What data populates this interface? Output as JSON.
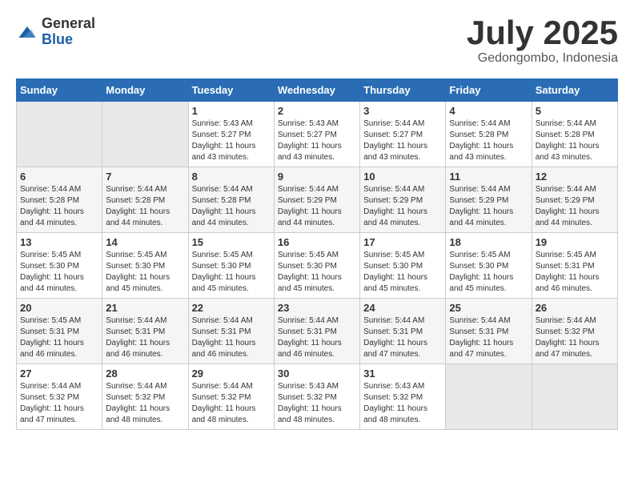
{
  "header": {
    "logo_general": "General",
    "logo_blue": "Blue",
    "month": "July 2025",
    "location": "Gedongombo, Indonesia"
  },
  "days_of_week": [
    "Sunday",
    "Monday",
    "Tuesday",
    "Wednesday",
    "Thursday",
    "Friday",
    "Saturday"
  ],
  "weeks": [
    [
      {
        "day": "",
        "sunrise": "",
        "sunset": "",
        "daylight": ""
      },
      {
        "day": "",
        "sunrise": "",
        "sunset": "",
        "daylight": ""
      },
      {
        "day": "1",
        "sunrise": "Sunrise: 5:43 AM",
        "sunset": "Sunset: 5:27 PM",
        "daylight": "Daylight: 11 hours and 43 minutes."
      },
      {
        "day": "2",
        "sunrise": "Sunrise: 5:43 AM",
        "sunset": "Sunset: 5:27 PM",
        "daylight": "Daylight: 11 hours and 43 minutes."
      },
      {
        "day": "3",
        "sunrise": "Sunrise: 5:44 AM",
        "sunset": "Sunset: 5:27 PM",
        "daylight": "Daylight: 11 hours and 43 minutes."
      },
      {
        "day": "4",
        "sunrise": "Sunrise: 5:44 AM",
        "sunset": "Sunset: 5:28 PM",
        "daylight": "Daylight: 11 hours and 43 minutes."
      },
      {
        "day": "5",
        "sunrise": "Sunrise: 5:44 AM",
        "sunset": "Sunset: 5:28 PM",
        "daylight": "Daylight: 11 hours and 43 minutes."
      }
    ],
    [
      {
        "day": "6",
        "sunrise": "Sunrise: 5:44 AM",
        "sunset": "Sunset: 5:28 PM",
        "daylight": "Daylight: 11 hours and 44 minutes."
      },
      {
        "day": "7",
        "sunrise": "Sunrise: 5:44 AM",
        "sunset": "Sunset: 5:28 PM",
        "daylight": "Daylight: 11 hours and 44 minutes."
      },
      {
        "day": "8",
        "sunrise": "Sunrise: 5:44 AM",
        "sunset": "Sunset: 5:28 PM",
        "daylight": "Daylight: 11 hours and 44 minutes."
      },
      {
        "day": "9",
        "sunrise": "Sunrise: 5:44 AM",
        "sunset": "Sunset: 5:29 PM",
        "daylight": "Daylight: 11 hours and 44 minutes."
      },
      {
        "day": "10",
        "sunrise": "Sunrise: 5:44 AM",
        "sunset": "Sunset: 5:29 PM",
        "daylight": "Daylight: 11 hours and 44 minutes."
      },
      {
        "day": "11",
        "sunrise": "Sunrise: 5:44 AM",
        "sunset": "Sunset: 5:29 PM",
        "daylight": "Daylight: 11 hours and 44 minutes."
      },
      {
        "day": "12",
        "sunrise": "Sunrise: 5:44 AM",
        "sunset": "Sunset: 5:29 PM",
        "daylight": "Daylight: 11 hours and 44 minutes."
      }
    ],
    [
      {
        "day": "13",
        "sunrise": "Sunrise: 5:45 AM",
        "sunset": "Sunset: 5:30 PM",
        "daylight": "Daylight: 11 hours and 44 minutes."
      },
      {
        "day": "14",
        "sunrise": "Sunrise: 5:45 AM",
        "sunset": "Sunset: 5:30 PM",
        "daylight": "Daylight: 11 hours and 45 minutes."
      },
      {
        "day": "15",
        "sunrise": "Sunrise: 5:45 AM",
        "sunset": "Sunset: 5:30 PM",
        "daylight": "Daylight: 11 hours and 45 minutes."
      },
      {
        "day": "16",
        "sunrise": "Sunrise: 5:45 AM",
        "sunset": "Sunset: 5:30 PM",
        "daylight": "Daylight: 11 hours and 45 minutes."
      },
      {
        "day": "17",
        "sunrise": "Sunrise: 5:45 AM",
        "sunset": "Sunset: 5:30 PM",
        "daylight": "Daylight: 11 hours and 45 minutes."
      },
      {
        "day": "18",
        "sunrise": "Sunrise: 5:45 AM",
        "sunset": "Sunset: 5:30 PM",
        "daylight": "Daylight: 11 hours and 45 minutes."
      },
      {
        "day": "19",
        "sunrise": "Sunrise: 5:45 AM",
        "sunset": "Sunset: 5:31 PM",
        "daylight": "Daylight: 11 hours and 46 minutes."
      }
    ],
    [
      {
        "day": "20",
        "sunrise": "Sunrise: 5:45 AM",
        "sunset": "Sunset: 5:31 PM",
        "daylight": "Daylight: 11 hours and 46 minutes."
      },
      {
        "day": "21",
        "sunrise": "Sunrise: 5:44 AM",
        "sunset": "Sunset: 5:31 PM",
        "daylight": "Daylight: 11 hours and 46 minutes."
      },
      {
        "day": "22",
        "sunrise": "Sunrise: 5:44 AM",
        "sunset": "Sunset: 5:31 PM",
        "daylight": "Daylight: 11 hours and 46 minutes."
      },
      {
        "day": "23",
        "sunrise": "Sunrise: 5:44 AM",
        "sunset": "Sunset: 5:31 PM",
        "daylight": "Daylight: 11 hours and 46 minutes."
      },
      {
        "day": "24",
        "sunrise": "Sunrise: 5:44 AM",
        "sunset": "Sunset: 5:31 PM",
        "daylight": "Daylight: 11 hours and 47 minutes."
      },
      {
        "day": "25",
        "sunrise": "Sunrise: 5:44 AM",
        "sunset": "Sunset: 5:31 PM",
        "daylight": "Daylight: 11 hours and 47 minutes."
      },
      {
        "day": "26",
        "sunrise": "Sunrise: 5:44 AM",
        "sunset": "Sunset: 5:32 PM",
        "daylight": "Daylight: 11 hours and 47 minutes."
      }
    ],
    [
      {
        "day": "27",
        "sunrise": "Sunrise: 5:44 AM",
        "sunset": "Sunset: 5:32 PM",
        "daylight": "Daylight: 11 hours and 47 minutes."
      },
      {
        "day": "28",
        "sunrise": "Sunrise: 5:44 AM",
        "sunset": "Sunset: 5:32 PM",
        "daylight": "Daylight: 11 hours and 48 minutes."
      },
      {
        "day": "29",
        "sunrise": "Sunrise: 5:44 AM",
        "sunset": "Sunset: 5:32 PM",
        "daylight": "Daylight: 11 hours and 48 minutes."
      },
      {
        "day": "30",
        "sunrise": "Sunrise: 5:43 AM",
        "sunset": "Sunset: 5:32 PM",
        "daylight": "Daylight: 11 hours and 48 minutes."
      },
      {
        "day": "31",
        "sunrise": "Sunrise: 5:43 AM",
        "sunset": "Sunset: 5:32 PM",
        "daylight": "Daylight: 11 hours and 48 minutes."
      },
      {
        "day": "",
        "sunrise": "",
        "sunset": "",
        "daylight": ""
      },
      {
        "day": "",
        "sunrise": "",
        "sunset": "",
        "daylight": ""
      }
    ]
  ]
}
